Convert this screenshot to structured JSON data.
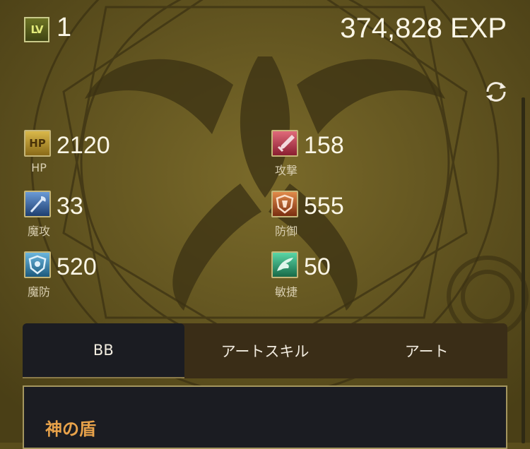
{
  "header": {
    "lv_badge": "LV",
    "level": "1",
    "exp": "374,828 EXP"
  },
  "stats": [
    {
      "badge": "HP",
      "value": "2120",
      "label": "HP",
      "icon": "hp-icon",
      "color": "#c8a63a"
    },
    {
      "badge": "",
      "value": "158",
      "label": "攻撃",
      "icon": "sword-icon",
      "color": "#c23b4e"
    },
    {
      "badge": "",
      "value": "33",
      "label": "魔攻",
      "icon": "wand-icon",
      "color": "#3b6fb0"
    },
    {
      "badge": "",
      "value": "555",
      "label": "防御",
      "icon": "shield-icon",
      "color": "#c45a22"
    },
    {
      "badge": "",
      "value": "520",
      "label": "魔防",
      "icon": "magic-shield-icon",
      "color": "#3c8db6"
    },
    {
      "badge": "",
      "value": "50",
      "label": "敏捷",
      "icon": "wing-icon",
      "color": "#2f9e6e"
    }
  ],
  "tabs": [
    {
      "label": "BB",
      "active": true
    },
    {
      "label": "アートスキル",
      "active": false
    },
    {
      "label": "アート",
      "active": false
    }
  ],
  "skill": {
    "name": "神の盾"
  }
}
